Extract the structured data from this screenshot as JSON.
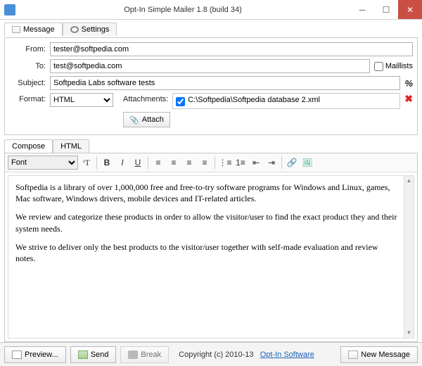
{
  "window": {
    "title": "Opt-In Simple Mailer 1.8 (build 34)"
  },
  "tabs_main": {
    "message": "Message",
    "settings": "Settings"
  },
  "form": {
    "from_label": "From:",
    "from_value": "tester@softpedia.com",
    "to_label": "To:",
    "to_value": "test@softpedia.com",
    "maillists_label": "Maillists",
    "subject_label": "Subject:",
    "subject_value": "Softpedia Labs software tests",
    "format_label": "Format:",
    "format_value": "HTML",
    "attachments_label": "Attachments:",
    "attach_button": "Attach",
    "attachment_path": "C:\\Softpedia\\Softpedia database 2.xml"
  },
  "compose_tabs": {
    "compose": "Compose",
    "html": "HTML"
  },
  "toolbar": {
    "font_placeholder": "Font"
  },
  "editor": {
    "p1": "Softpedia is a library of over 1,000,000 free and free-to-try software programs for Windows and Linux, games, Mac software, Windows drivers, mobile devices and IT-related articles.",
    "p2": "We review and categorize these products in order to allow the visitor/user to find the exact product they and their system needs.",
    "p3": "We strive to deliver only the best products to the visitor/user together with self-made evaluation and review notes."
  },
  "footer": {
    "preview": "Preview...",
    "send": "Send",
    "break": "Break",
    "copyright_text": "Copyright (c) 2010-13",
    "link_text": "Opt-In Software",
    "new_message": "New Message"
  },
  "symbols": {
    "pct": "%",
    "x": "✖"
  }
}
